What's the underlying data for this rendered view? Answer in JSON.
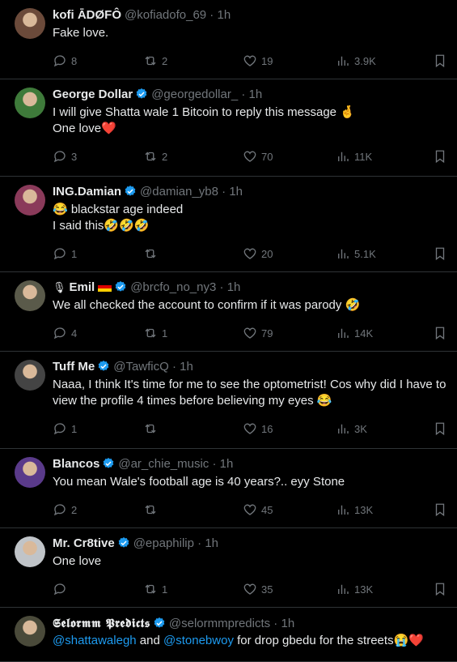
{
  "tweets": [
    {
      "name": "kofi ĀDØFÔ",
      "verified": false,
      "handle": "@kofiadofo_69",
      "time": "1h",
      "lines": [
        "Fake love."
      ],
      "replies": "8",
      "reposts": "2",
      "likes": "19",
      "views": "3.9K",
      "avatar_color": "#6b4a3a"
    },
    {
      "name": "George Dollar",
      "verified": true,
      "handle": "@georgedollar_",
      "time": "1h",
      "lines": [
        "I will give Shatta wale 1 Bitcoin to reply this message 🤞",
        "One love❤️"
      ],
      "replies": "3",
      "reposts": "2",
      "likes": "70",
      "views": "11K",
      "avatar_color": "#3e7a3a"
    },
    {
      "name": "ING.Damian",
      "verified": true,
      "handle": "@damian_yb8",
      "time": "1h",
      "lines": [
        "😂 blackstar age indeed",
        "I said this🤣🤣🤣"
      ],
      "replies": "1",
      "reposts": "",
      "likes": "20",
      "views": "5.1K",
      "avatar_color": "#8a3a5a"
    },
    {
      "name": "Emil",
      "verified": true,
      "handle": "@brcfo_no_ny3",
      "time": "1h",
      "lines": [
        "We all checked the account to confirm if it was parody 🤣"
      ],
      "replies": "4",
      "reposts": "1",
      "likes": "79",
      "views": "14K",
      "avatar_color": "#5a5a4a"
    },
    {
      "name": "Tuff Me",
      "verified": true,
      "handle": "@TawficQ",
      "time": "1h",
      "lines": [
        "Naaa, I think It's time for me to see the optometrist! Cos why did I have to",
        "view the profile 4 times before believing my eyes 😂"
      ],
      "replies": "1",
      "reposts": "",
      "likes": "16",
      "views": "3K",
      "avatar_color": "#444"
    },
    {
      "name": "Blancos",
      "verified": true,
      "handle": "@ar_chie_music",
      "time": "1h",
      "lines": [
        "You mean Wale's football age is 40 years?.. eyy Stone"
      ],
      "replies": "2",
      "reposts": "",
      "likes": "45",
      "views": "13K",
      "avatar_color": "#5a3a8a"
    },
    {
      "name": "Mr. Cr8tive",
      "verified": true,
      "handle": "@epaphilip",
      "time": "1h",
      "lines": [
        "One love"
      ],
      "replies": "",
      "reposts": "1",
      "likes": "35",
      "views": "13K",
      "avatar_color": "#c0c4c8"
    },
    {
      "name": "𝕾𝖊𝖑𝖔𝖗𝖒𝖒 𝕻𝖗𝖊𝖉𝖎𝖈𝖙𝖘",
      "verified": true,
      "handle": "@selormmpredicts",
      "time": "1h",
      "mention1": "@shattawalegh",
      "and_text": " and ",
      "mention2": "@stonebwoy",
      "rest_text": " for drop gbedu for the streets😭❤️",
      "avatar_color": "#4a4a3a"
    }
  ],
  "icons": {
    "reply": "reply-icon",
    "repost": "repost-icon",
    "like": "heart-icon",
    "views": "views-icon",
    "bookmark": "bookmark-icon",
    "verified": "verified-badge-icon"
  },
  "colors": {
    "accent": "#1d9bf0",
    "muted": "#71767b",
    "text": "#e7e9ea",
    "divider": "#2f3336"
  }
}
